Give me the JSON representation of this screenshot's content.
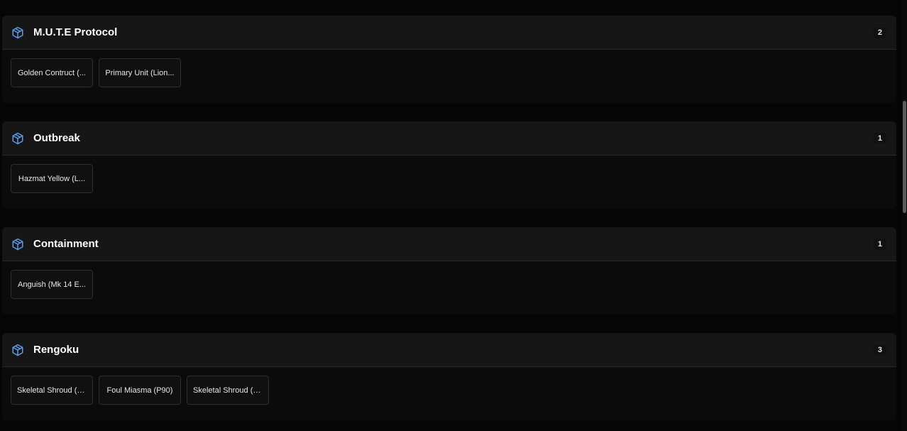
{
  "colors": {
    "background": "#060606",
    "header": "#161616",
    "icon_accent": "#5b9bea",
    "text": "#ffffff"
  },
  "icons": {
    "section": "cube-icon"
  },
  "sections": [
    {
      "title": "M.U.T.E Protocol",
      "count": "2",
      "items": [
        "Golden Contruct (...",
        "Primary Unit (Lion..."
      ]
    },
    {
      "title": "Outbreak",
      "count": "1",
      "items": [
        "Hazmat Yellow (L..."
      ]
    },
    {
      "title": "Containment",
      "count": "1",
      "items": [
        "Anguish (Mk 14 E..."
      ]
    },
    {
      "title": "Rengoku",
      "count": "3",
      "items": [
        "Skeletal Shroud (R...",
        "Foul Miasma (P90)",
        "Skeletal Shroud (R..."
      ]
    }
  ]
}
